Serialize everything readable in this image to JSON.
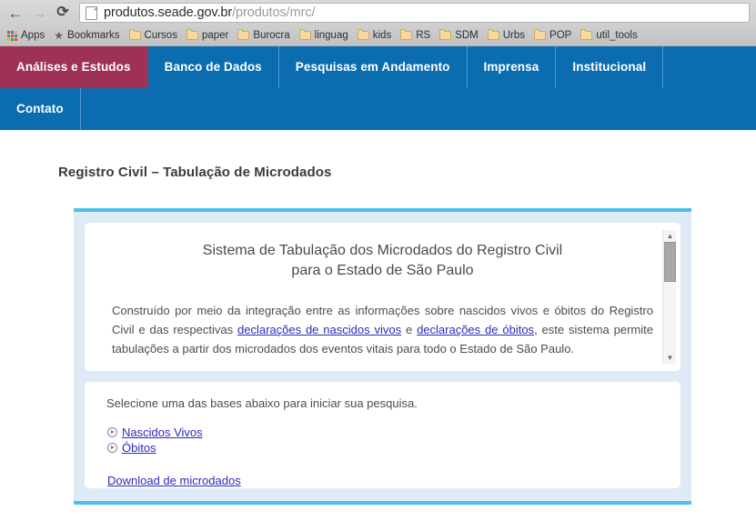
{
  "browser": {
    "back_icon": "←",
    "forward_icon": "→",
    "reload_icon": "⟳",
    "url_domain": "produtos.seade.gov.br",
    "url_path": "/produtos/mrc/",
    "bookmarks": [
      {
        "label": "Apps",
        "icon": "apps-grid-icon"
      },
      {
        "label": "Bookmarks",
        "icon": "star-icon"
      },
      {
        "label": "Cursos",
        "icon": "folder-icon"
      },
      {
        "label": "paper",
        "icon": "folder-icon"
      },
      {
        "label": "Burocra",
        "icon": "folder-icon"
      },
      {
        "label": "linguag",
        "icon": "folder-icon"
      },
      {
        "label": "kids",
        "icon": "folder-icon"
      },
      {
        "label": "RS",
        "icon": "folder-icon"
      },
      {
        "label": "SDM",
        "icon": "folder-icon"
      },
      {
        "label": "Urbs",
        "icon": "folder-icon"
      },
      {
        "label": "POP",
        "icon": "folder-icon"
      },
      {
        "label": "util_tools",
        "icon": "folder-icon"
      }
    ]
  },
  "site_nav": {
    "row1": [
      {
        "label": "Análises e Estudos",
        "active": true
      },
      {
        "label": "Banco de Dados",
        "active": false
      },
      {
        "label": "Pesquisas em Andamento",
        "active": false
      },
      {
        "label": "Imprensa",
        "active": false
      },
      {
        "label": "Institucional",
        "active": false
      }
    ],
    "row2": [
      {
        "label": "Contato",
        "active": false
      }
    ]
  },
  "page": {
    "title": "Registro Civil – Tabulação de Microdados"
  },
  "intro": {
    "heading_line1": "Sistema de Tabulação dos Microdados do Registro Civil",
    "heading_line2": "para o Estado de São Paulo",
    "paragraph_part1": "Construído por meio da integração entre as informações sobre nascidos vivos e óbitos do Registro Civil e das respectivas ",
    "link1": "declarações de nascidos vivos",
    "paragraph_part2": " e ",
    "link2": "declarações de óbitos",
    "paragraph_part3": ", este sistema permite tabulações a partir dos microdados dos eventos vitais para todo o Estado de São Paulo."
  },
  "select_section": {
    "prompt": "Selecione uma das bases abaixo para iniciar sua pesquisa.",
    "bases": [
      {
        "label": "Nascidos Vivos"
      },
      {
        "label": "Óbitos"
      }
    ],
    "download_label": "Download de microdados"
  },
  "scrollbar": {
    "up_arrow": "▲",
    "down_arrow": "▼"
  },
  "colors": {
    "nav_blue": "#0c6cb0",
    "nav_active_maroon": "#9e3156",
    "shell_bg": "#dfeaf7",
    "shell_accent_cyan": "#4cc0e8",
    "link_blue": "#2b2bbb"
  }
}
